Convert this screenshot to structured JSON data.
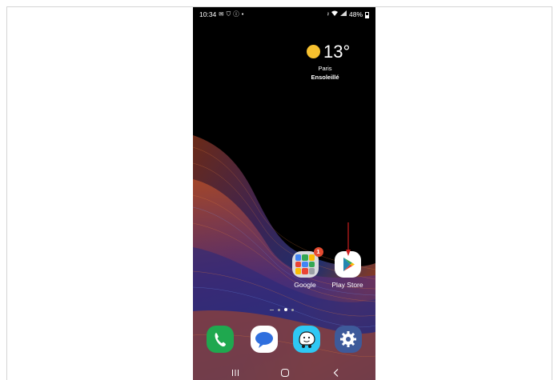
{
  "status_bar": {
    "time": "10:34",
    "left_icons": [
      "mail-icon",
      "shield-icon",
      "info-icon",
      "dot-icon"
    ],
    "right_icons": [
      "mute-icon",
      "wifi-icon",
      "signal-icon"
    ],
    "battery": "48%",
    "battery_level": 0.48
  },
  "weather": {
    "temperature": "13°",
    "city": "Paris",
    "condition": "Ensoleillé",
    "icon": "sun-icon"
  },
  "apps": {
    "google": {
      "label": "Google",
      "badge": "1",
      "icon": "folder-icon"
    },
    "play_store": {
      "label": "Play Store",
      "icon": "play-store-icon"
    }
  },
  "page_indicator": {
    "pages": 3,
    "active": 1
  },
  "dock": [
    "phone-icon",
    "messages-icon",
    "waze-icon",
    "settings-icon"
  ],
  "nav": [
    "recent-apps-icon",
    "home-icon",
    "back-icon"
  ],
  "colors": {
    "annotation_arrow": "#cc1f1f",
    "phone_app": "#1fa84f",
    "waze_app": "#2ec8f4",
    "settings_app": "#3e5a9a",
    "badge": "#e44b30"
  }
}
